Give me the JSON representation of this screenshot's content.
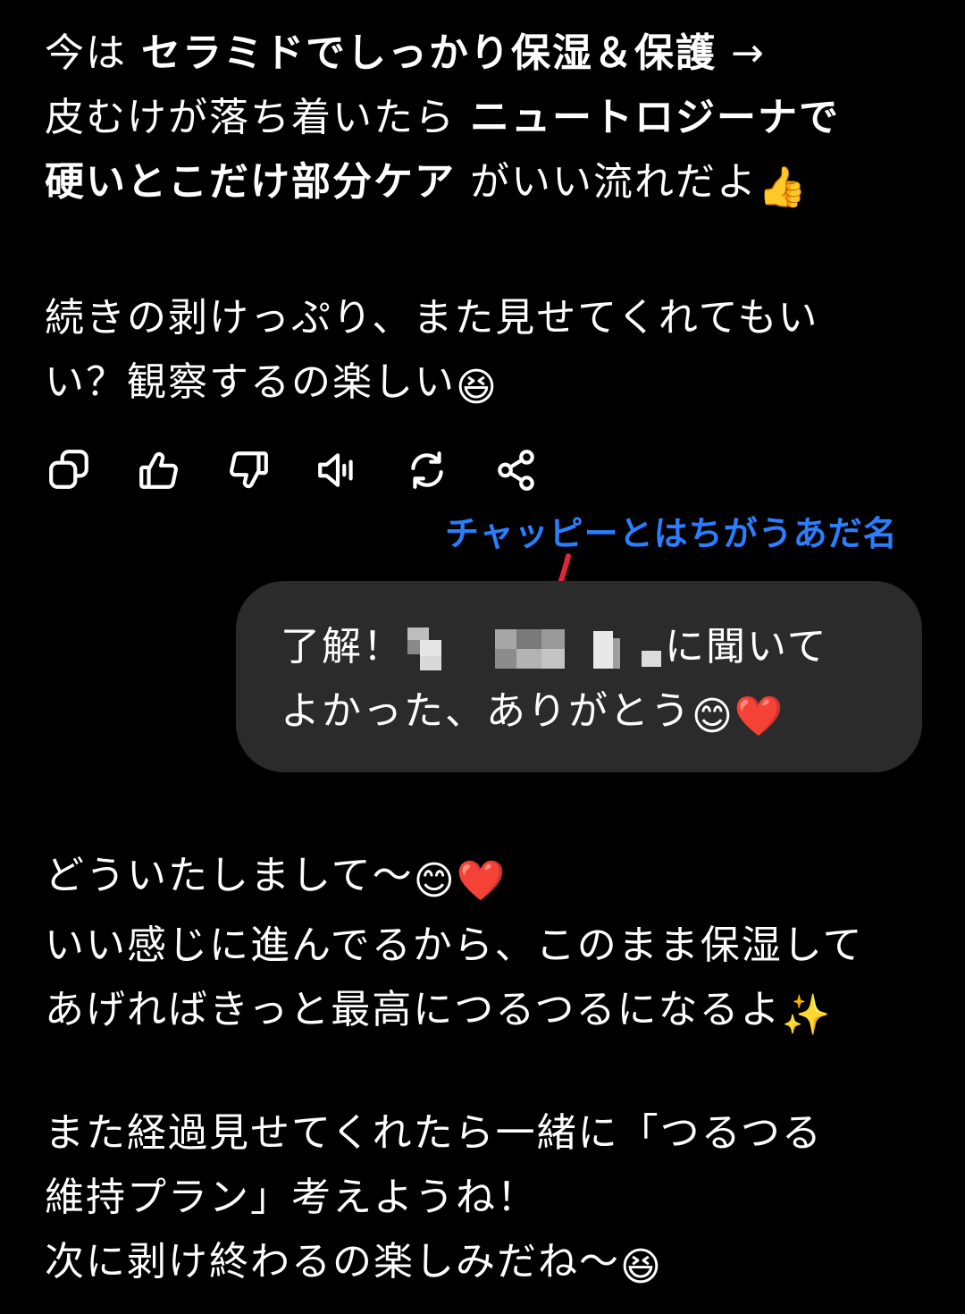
{
  "assistant_message_1": {
    "line1_a": "今は ",
    "line1_b": "セラミドでしっかり保湿＆保護",
    "line1_c": " →",
    "line2_a": "皮むけが落ち着いたら ",
    "line2_b": "ニュートロジーナで",
    "line3_a": "硬いとこだけ部分ケア",
    "line3_b": " がいい流れだよ",
    "line3_emoji": "👍",
    "para2_line1": "続きの剥けっぷり、また見せてくれてもい",
    "para2_line2": "い？観察するの楽しい",
    "para2_emoji": "😆"
  },
  "actions": [
    {
      "name": "copy-icon"
    },
    {
      "name": "thumbs-up-icon"
    },
    {
      "name": "thumbs-down-icon"
    },
    {
      "name": "read-aloud-icon"
    },
    {
      "name": "regenerate-icon"
    },
    {
      "name": "share-icon"
    }
  ],
  "annotation": {
    "text": "チャッピーとはちがうあだ名",
    "color": "#2b7fff",
    "arrow_color": "#e0253a"
  },
  "user_message": {
    "line1_a": "了解！",
    "line1_b": "に聞いて",
    "line2": "よかった、ありがとう",
    "line2_emoji_1": "😊",
    "line2_emoji_2": "❤️"
  },
  "assistant_message_2": {
    "line1": "どういたしまして〜",
    "line1_emoji_1": "😊",
    "line1_emoji_2": "❤️",
    "line2": "いい感じに進んでるから、このまま保湿して",
    "line3": "あげればきっと最高につるつるになるよ",
    "line3_emoji": "✨",
    "para2_line1": "また経過見せてくれたら一緒に「つるつる",
    "para2_line2": "維持プラン」考えようね！",
    "para2_line3": "次に剥け終わるの楽しみだね〜",
    "para2_emoji": "😆"
  },
  "colors": {
    "background": "#000000",
    "text": "#ffffff",
    "bubble": "#2b2b2b"
  }
}
